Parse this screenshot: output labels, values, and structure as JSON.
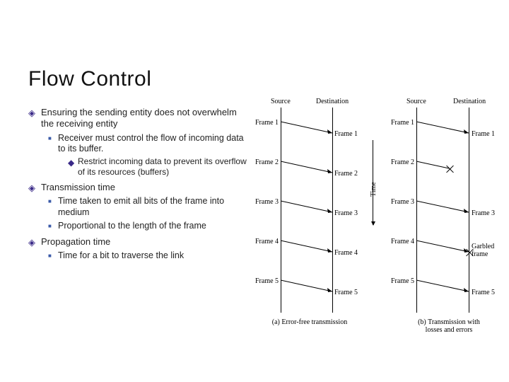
{
  "title": "Flow Control",
  "bullets": {
    "b1": "Ensuring the sending entity does not overwhelm the receiving entity",
    "b1a": "Receiver must control the flow of incoming data to its buffer.",
    "b1a1": "Restrict incoming data to prevent its overflow of its resources (buffers)",
    "b2": "Transmission time",
    "b2a": "Time taken to emit all bits of the frame into medium",
    "b2b": "Proportional to the length of the frame",
    "b3": "Propagation time",
    "b3a": "Time for a bit to traverse the link"
  },
  "figure": {
    "headers": {
      "srcA": "Source",
      "dstA": "Destination",
      "srcB": "Source",
      "dstB": "Destination"
    },
    "frames": {
      "f1": "Frame 1",
      "f2": "Frame 2",
      "f3": "Frame 3",
      "f4": "Frame 4",
      "f5": "Frame 5"
    },
    "garbled": "Garbled\nframe",
    "time": "Time",
    "captions": {
      "a": "(a) Error-free transmission",
      "b": "(b) Transmission with\nlosses and errors"
    }
  }
}
